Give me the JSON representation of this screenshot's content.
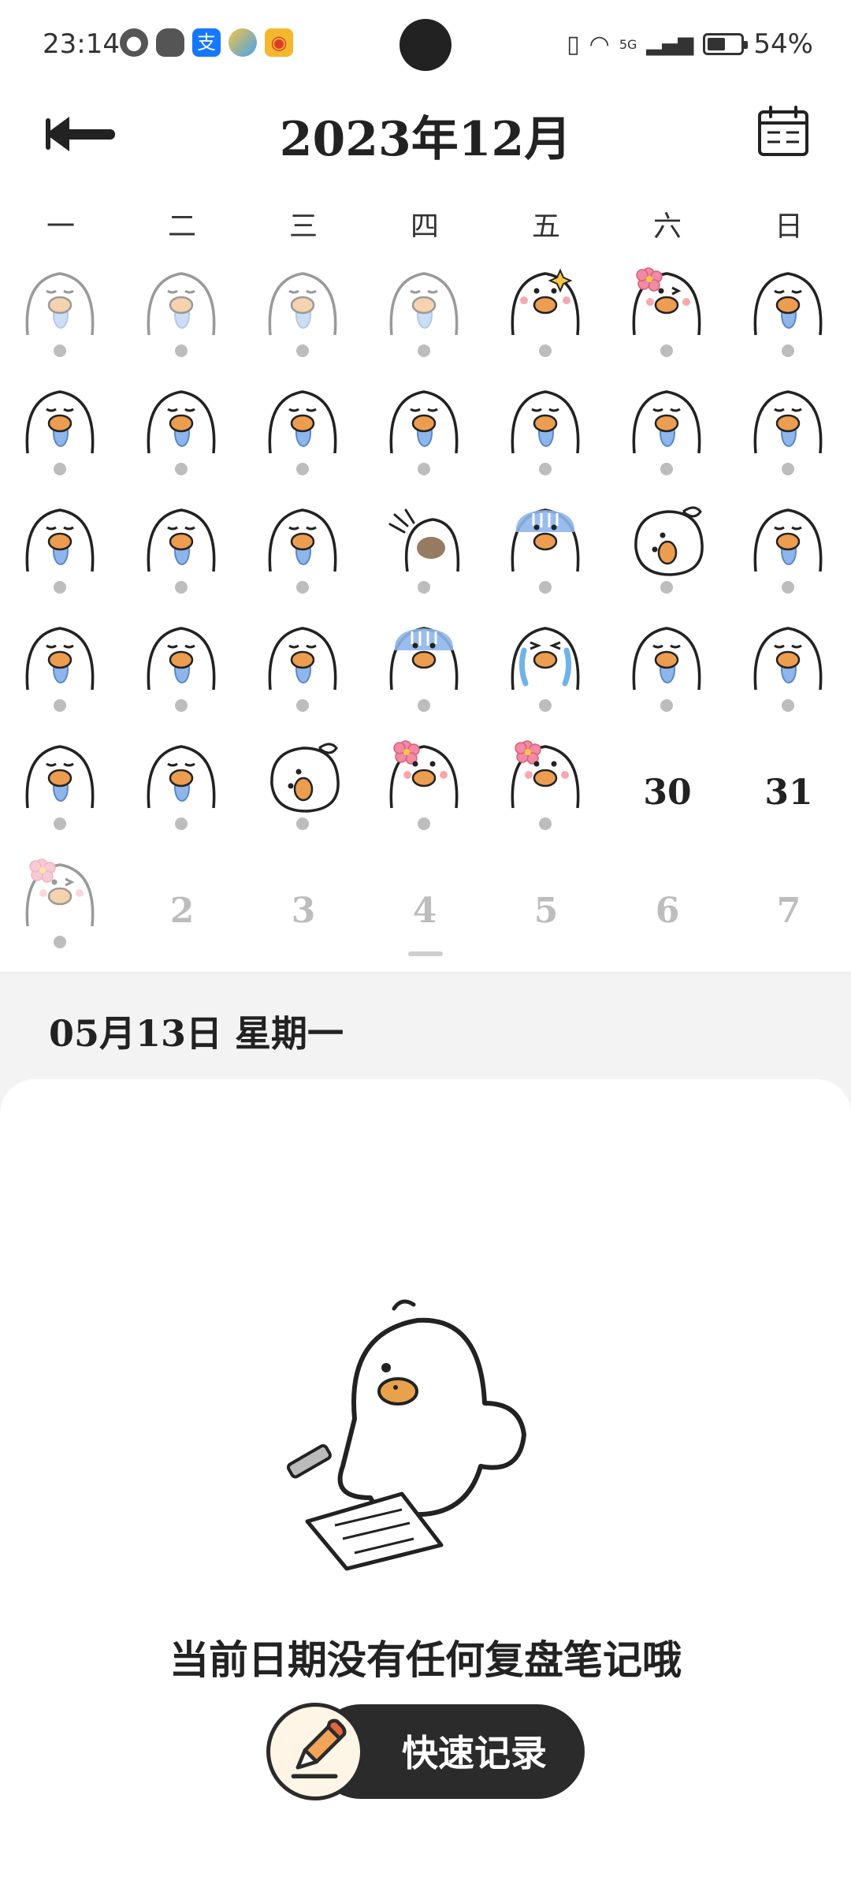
{
  "status_bar": {
    "time": "23:14",
    "battery": "54%",
    "battery_level": 0.54,
    "app_icons": [
      "wechat-icon",
      "qq-icon",
      "alipay-icon",
      "pinwheel-icon",
      "weibo-icon"
    ],
    "signal_label": "5G"
  },
  "header": {
    "title": "2023年12月"
  },
  "weekdays": [
    "一",
    "二",
    "三",
    "四",
    "五",
    "六",
    "日"
  ],
  "calendar": {
    "rows": [
      [
        "faded-sleep",
        "faded-sleep",
        "faded-sleep",
        "faded-sleep",
        "sparkle",
        "flower-wink",
        "sleep"
      ],
      [
        "sleep",
        "sleep",
        "sleep",
        "sleep",
        "sleep",
        "sleep",
        "sleep"
      ],
      [
        "sleep",
        "sleep",
        "sleep",
        "wave",
        "gloomy",
        "lying",
        "sleep"
      ],
      [
        "sleep",
        "sleep",
        "sleep",
        "gloomy",
        "crying",
        "sleep",
        "sleep"
      ],
      [
        "sleep",
        "sleep",
        "lying",
        "flower",
        "flower",
        "30",
        "31"
      ],
      [
        "faded-flower-wink",
        "2",
        "3",
        "4",
        "5",
        "6",
        "7"
      ]
    ],
    "next_month_days": [
      "2",
      "3",
      "4",
      "5",
      "6",
      "7"
    ]
  },
  "selected_date": "05月13日 星期一",
  "empty_state": {
    "message": "当前日期没有任何复盘笔记哦",
    "button_label": "快速记录"
  }
}
